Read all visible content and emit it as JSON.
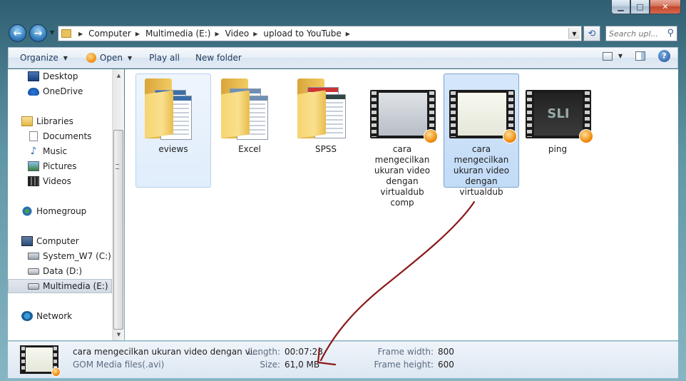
{
  "window": {
    "caption": {
      "minimize": "▁",
      "maximize": "□",
      "close": "✕"
    }
  },
  "address": {
    "segments": [
      "Computer",
      "Multimedia (E:)",
      "Video",
      "upload to YouTube"
    ],
    "search_placeholder": "Search upl..."
  },
  "toolbar": {
    "organize": "Organize",
    "open": "Open",
    "play_all": "Play all",
    "new_folder": "New folder"
  },
  "sidebar": {
    "items": [
      {
        "label": "Desktop",
        "icon": "desktop-icon"
      },
      {
        "label": "OneDrive",
        "icon": "onedrive-icon"
      },
      {
        "label": "Libraries",
        "icon": "libraries-icon"
      },
      {
        "label": "Documents",
        "icon": "documents-icon"
      },
      {
        "label": "Music",
        "icon": "music-icon"
      },
      {
        "label": "Pictures",
        "icon": "pictures-icon"
      },
      {
        "label": "Videos",
        "icon": "videos-icon"
      },
      {
        "label": "Homegroup",
        "icon": "homegroup-icon"
      },
      {
        "label": "Computer",
        "icon": "computer-icon"
      },
      {
        "label": "System_W7 (C:)",
        "icon": "system-drive-icon"
      },
      {
        "label": "Data (D:)",
        "icon": "drive-icon"
      },
      {
        "label": "Multimedia (E:)",
        "icon": "drive-icon",
        "selected": true
      },
      {
        "label": "Network",
        "icon": "network-icon"
      }
    ]
  },
  "files": [
    {
      "name": "eviews",
      "type": "folder",
      "state": "hover"
    },
    {
      "name": "Excel",
      "type": "folder"
    },
    {
      "name": "SPSS",
      "type": "folder"
    },
    {
      "name": "cara mengecilkan ukuran video dengan virtualdub comp",
      "type": "video"
    },
    {
      "name": "cara mengecilkan ukuran video dengan virtualdub",
      "type": "video",
      "state": "selected"
    },
    {
      "name": "ping",
      "type": "video",
      "thumb_text": "SLI"
    }
  ],
  "details": {
    "filename": "cara mengecilkan ukuran video dengan vi...",
    "filetype": "GOM Media files(.avi)",
    "length_label": "Length:",
    "length_value": "00:07:28",
    "size_label": "Size:",
    "size_value": "61,0 MB",
    "frame_width_label": "Frame width:",
    "frame_width_value": "800",
    "frame_height_label": "Frame height:",
    "frame_height_value": "600"
  },
  "colors": {
    "selection": "#c2dbf7",
    "annotation_arrow": "#8b1a1a"
  }
}
